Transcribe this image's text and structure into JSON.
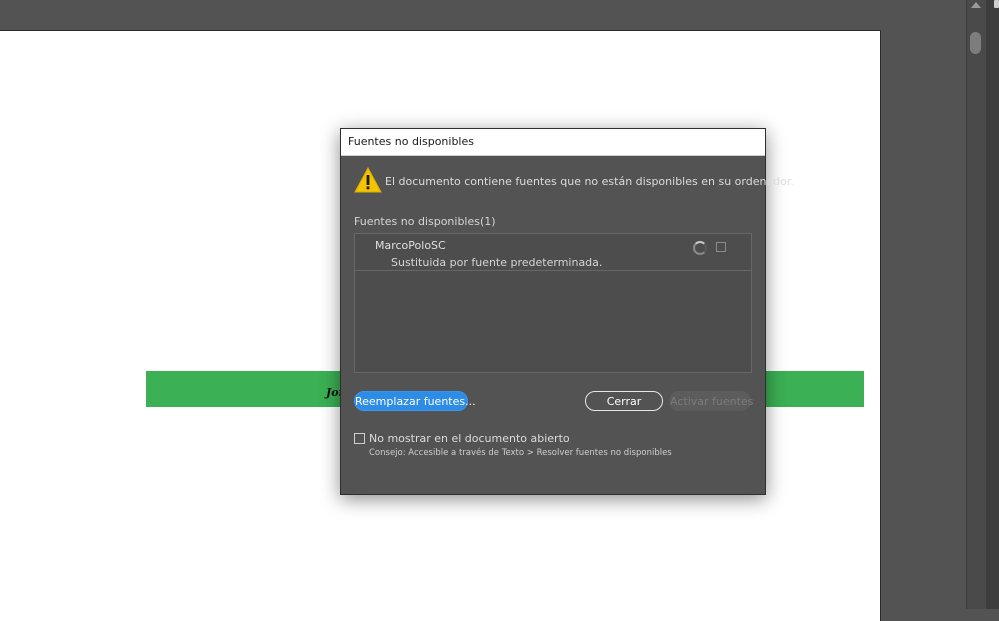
{
  "document": {
    "band_text": "Jorg"
  },
  "dialog": {
    "title": "Fuentes no disponibles",
    "warning_message": "El documento contiene fuentes que no están disponibles en su ordenador.",
    "warning_icon": "warning-triangle-icon",
    "list_label": "Fuentes no disponibles(1)",
    "fonts": [
      {
        "name": "MarcoPoloSC",
        "status": "Sustituida por fuente predeterminada."
      }
    ],
    "buttons": {
      "replace": "Reemplazar fuentes...",
      "close": "Cerrar",
      "activate": "Activar fuentes"
    },
    "dont_show_label": "No mostrar en el documento abierto",
    "tip": "Consejo: Accesible a través de Texto > Resolver fuentes no disponibles"
  },
  "colors": {
    "primary_button": "#2c8ce6",
    "band": "#3bb054",
    "warning": "#f5c400"
  }
}
